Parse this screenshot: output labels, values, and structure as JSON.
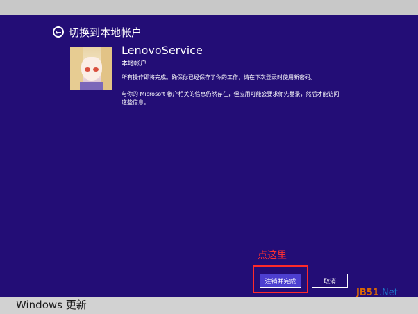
{
  "header": {
    "title": "切换到本地帐户"
  },
  "account": {
    "username": "LenovoService",
    "type_label": "本地帐户"
  },
  "messages": [
    "所有操作即将完成。确保你已经保存了你的工作，请在下次登录时使用新密码。",
    "与你的 Microsoft 帐户相关的信息仍然存在，但应用可能会要求你先登录，然后才能访问这些信息。"
  ],
  "annotation": {
    "text": "点这里",
    "color": "#ff3030"
  },
  "buttons": {
    "finish_label": "注销并完成",
    "cancel_label": "取消"
  },
  "footer": {
    "text": "Windows 更新"
  },
  "watermark": {
    "part_a": "JB51",
    "part_b": ".Net"
  },
  "colors": {
    "background": "#230d76",
    "button_accent": "#4d3fd0",
    "highlight": "#ff2a2a"
  },
  "icons": {
    "back": "back-arrow-icon"
  }
}
